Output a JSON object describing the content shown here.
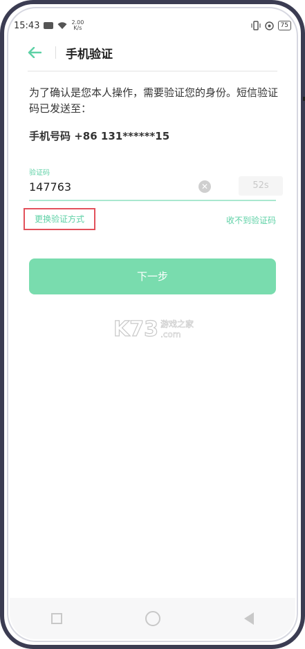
{
  "status_bar": {
    "time": "15:43",
    "net_speed_value": "2.00",
    "net_speed_unit": "K/s",
    "battery": "75",
    "icons": [
      "sim-icon",
      "wifi-icon",
      "vibrate-icon",
      "data-saver-icon",
      "battery-icon"
    ]
  },
  "header": {
    "back_icon": "arrow-left-icon",
    "title": "手机验证"
  },
  "description": "为了确认是您本人操作，需要验证您的身份。短信验证码已发送至：",
  "phone_line": "手机号码 +86 131******15",
  "code_field": {
    "label": "验证码",
    "value": "147763"
  },
  "countdown": "52s",
  "switch_method": "更换验证方式",
  "no_code": "收不到验证码",
  "next_button": "下一步",
  "watermark": {
    "brand": "K73",
    "tagline": "游戏之家",
    "domain": ".com"
  },
  "colors": {
    "accent": "#5ed1a6",
    "button": "#79dcae",
    "highlight_box": "#e2505a"
  }
}
